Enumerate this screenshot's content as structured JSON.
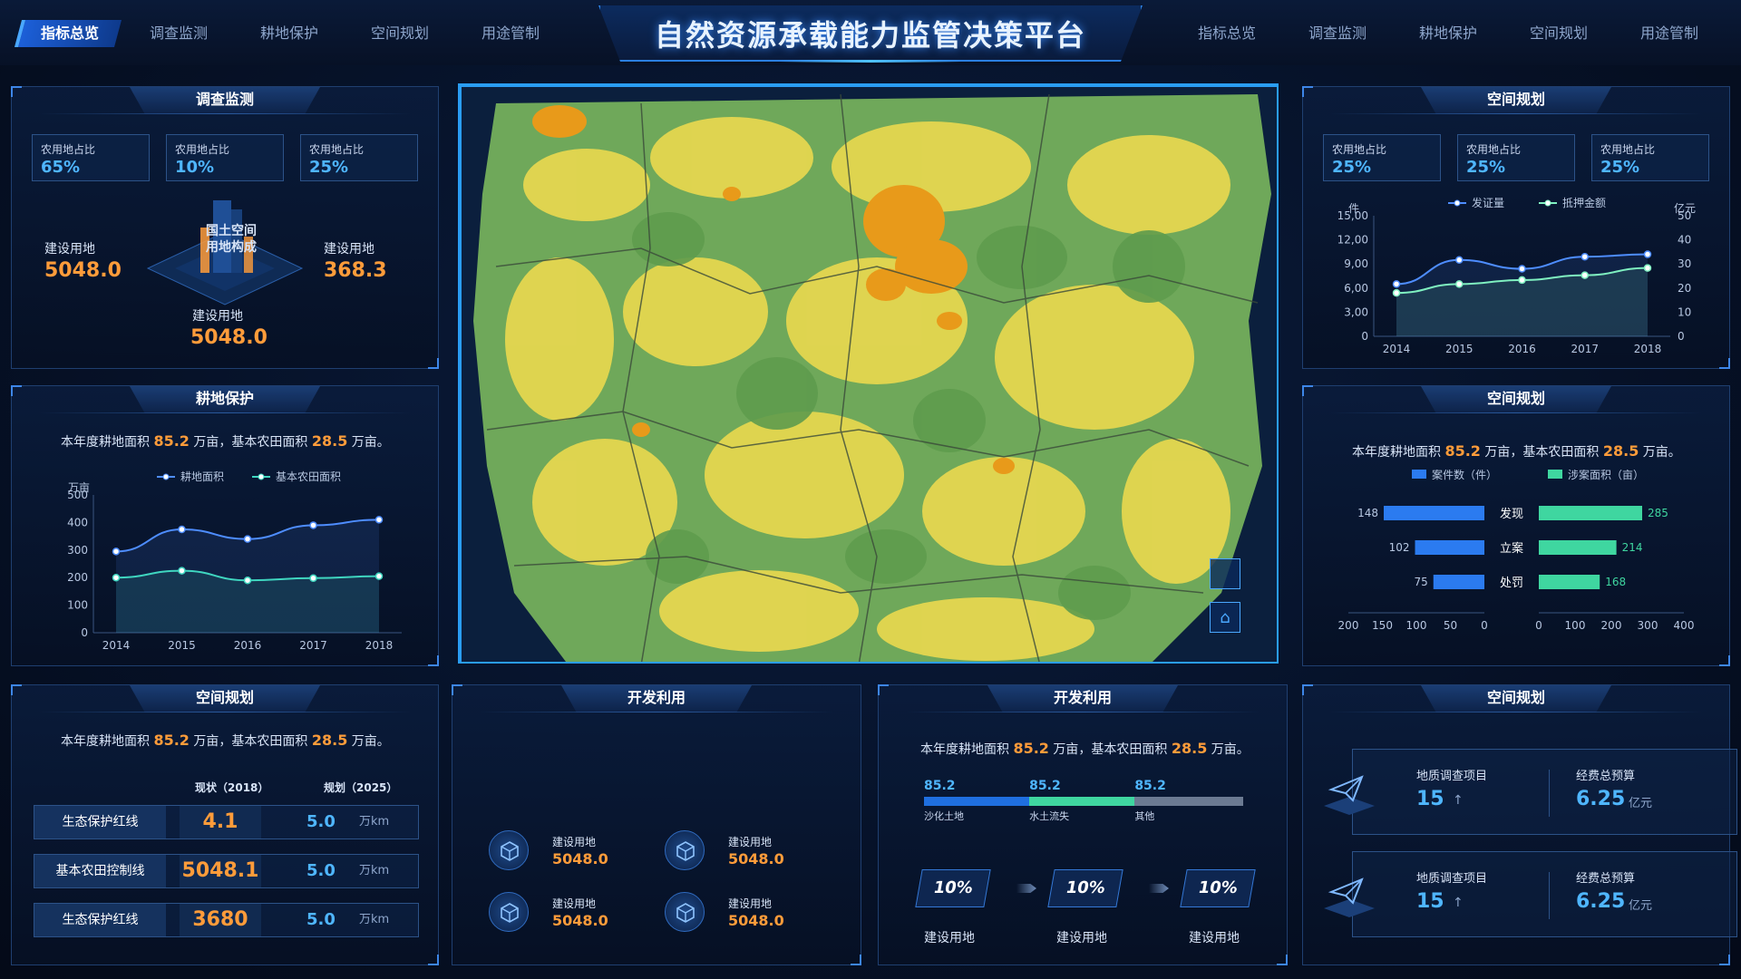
{
  "nav": {
    "left": [
      "指标总览",
      "调查监测",
      "耕地保护",
      "空间规划",
      "用途管制"
    ],
    "right": [
      "指标总览",
      "调查监测",
      "耕地保护",
      "空间规划",
      "用途管制"
    ],
    "active": "指标总览"
  },
  "title": "自然资源承载能力监管决策平台",
  "survey": {
    "title": "调查监测",
    "stats": [
      {
        "label": "农用地占比",
        "value": "65%"
      },
      {
        "label": "农用地占比",
        "value": "10%"
      },
      {
        "label": "农用地占比",
        "value": "25%"
      }
    ],
    "center_label": "国土空间\n用地构成",
    "left": {
      "label": "建设用地",
      "value": "5048.0"
    },
    "right": {
      "label": "建设用地",
      "value": "368.3"
    },
    "bottom": {
      "label": "建设用地",
      "value": "5048.0"
    }
  },
  "farmland": {
    "title": "耕地保护",
    "sentence": {
      "a": "本年度耕地面积 ",
      "v1": "85.2",
      "b": " 万亩，基本农田面积 ",
      "v2": "28.5",
      "c": " 万亩。"
    }
  },
  "planning_rows": {
    "title": "空间规划",
    "sentence": {
      "a": "本年度耕地面积 ",
      "v1": "85.2",
      "b": " 万亩，基本农田面积 ",
      "v2": "28.5",
      "c": " 万亩。"
    },
    "col_now": "现状（2018）",
    "col_plan": "规划（2025）",
    "rows": [
      {
        "name": "生态保护红线",
        "now": "4.1",
        "plan": "5.0",
        "unit": "万km"
      },
      {
        "name": "基本农田控制线",
        "now": "5048.1",
        "plan": "5.0",
        "unit": "万km"
      },
      {
        "name": "生态保护红线",
        "now": "3680",
        "plan": "5.0",
        "unit": "万km"
      }
    ]
  },
  "dev1": {
    "title": "开发利用",
    "items": [
      {
        "label": "建设用地",
        "value": "5048.0"
      },
      {
        "label": "建设用地",
        "value": "5048.0"
      },
      {
        "label": "建设用地",
        "value": "5048.0"
      },
      {
        "label": "建设用地",
        "value": "5048.0"
      }
    ]
  },
  "dev2": {
    "title": "开发利用",
    "sentence": {
      "a": "本年度耕地面积 ",
      "v1": "85.2",
      "b": " 万亩，基本农田面积 ",
      "v2": "28.5",
      "c": " 万亩。"
    },
    "bar": [
      {
        "value": "85.2",
        "label": "沙化土地",
        "color": "#1f6fe0",
        "share": 0.33
      },
      {
        "value": "85.2",
        "label": "水土流失",
        "color": "#3fd6a0",
        "share": 0.33
      },
      {
        "value": "85.2",
        "label": "其他",
        "color": "#6b7a92",
        "share": 0.34
      }
    ],
    "steps": [
      {
        "pct": "10%",
        "label": "建设用地"
      },
      {
        "pct": "10%",
        "label": "建设用地"
      },
      {
        "pct": "10%",
        "label": "建设用地"
      }
    ]
  },
  "planning_line": {
    "title": "空间规划",
    "stats": [
      {
        "label": "农用地占比",
        "value": "25%"
      },
      {
        "label": "农用地占比",
        "value": "25%"
      },
      {
        "label": "农用地占比",
        "value": "25%"
      }
    ]
  },
  "planning_bar": {
    "title": "空间规划",
    "sentence": {
      "a": "本年度耕地面积 ",
      "v1": "85.2",
      "b": " 万亩，基本农田面积 ",
      "v2": "28.5",
      "c": " 万亩。"
    }
  },
  "planning_proj": {
    "title": "空间规划",
    "items": [
      {
        "label": "地质调查项目",
        "value": "15",
        "arrow": "↑",
        "budget_label": "经费总预算",
        "budget": "6.25",
        "unit": "亿元"
      },
      {
        "label": "地质调查项目",
        "value": "15",
        "arrow": "↑",
        "budget_label": "经费总预算",
        "budget": "6.25",
        "unit": "亿元"
      }
    ]
  },
  "chart_data": [
    {
      "type": "line",
      "id": "farm",
      "x": [
        "2014",
        "2015",
        "2016",
        "2017",
        "2018"
      ],
      "ylabel": "万亩",
      "ylim": [
        0,
        500
      ],
      "yticks": [
        "0",
        "100",
        "200",
        "300",
        "400",
        "500"
      ],
      "series": [
        {
          "name": "耕地面积",
          "color": "#4e8dff",
          "values": [
            295,
            375,
            340,
            390,
            410
          ]
        },
        {
          "name": "基本农田面积",
          "color": "#3fd6c0",
          "values": [
            200,
            225,
            190,
            198,
            205
          ]
        }
      ]
    },
    {
      "type": "line",
      "id": "plan",
      "x": [
        "2014",
        "2015",
        "2016",
        "2017",
        "2018"
      ],
      "ylabel": "件",
      "ylabel_right": "亿元",
      "ylim": [
        0,
        15
      ],
      "yticks": [
        "0",
        "3,00",
        "6,00",
        "9,00",
        "12,00",
        "15,00"
      ],
      "ylim_right": [
        0,
        50
      ],
      "yticks_right": [
        "0",
        "10",
        "20",
        "30",
        "40",
        "50"
      ],
      "series": [
        {
          "name": "发证量",
          "color": "#4e8dff",
          "values": [
            6.5,
            9.5,
            8.4,
            9.9,
            10.2
          ]
        },
        {
          "name": "抵押金额",
          "color": "#7ff0c0",
          "values": [
            5.4,
            6.5,
            7.0,
            7.6,
            8.5
          ]
        }
      ]
    },
    {
      "type": "bar",
      "id": "case",
      "categories": [
        "发现",
        "立案",
        "处罚"
      ],
      "series": [
        {
          "name": "案件数（件）",
          "color": "#2b7bf0",
          "values": [
            148,
            102,
            75
          ]
        },
        {
          "name": "涉案面积（亩）",
          "color": "#3fd6a0",
          "values": [
            285,
            214,
            168
          ]
        }
      ],
      "left_ticks": [
        "200",
        "150",
        "100",
        "50",
        "0"
      ],
      "right_ticks": [
        "0",
        "100",
        "200",
        "300",
        "400"
      ],
      "left_max": 200,
      "right_max": 400
    }
  ]
}
